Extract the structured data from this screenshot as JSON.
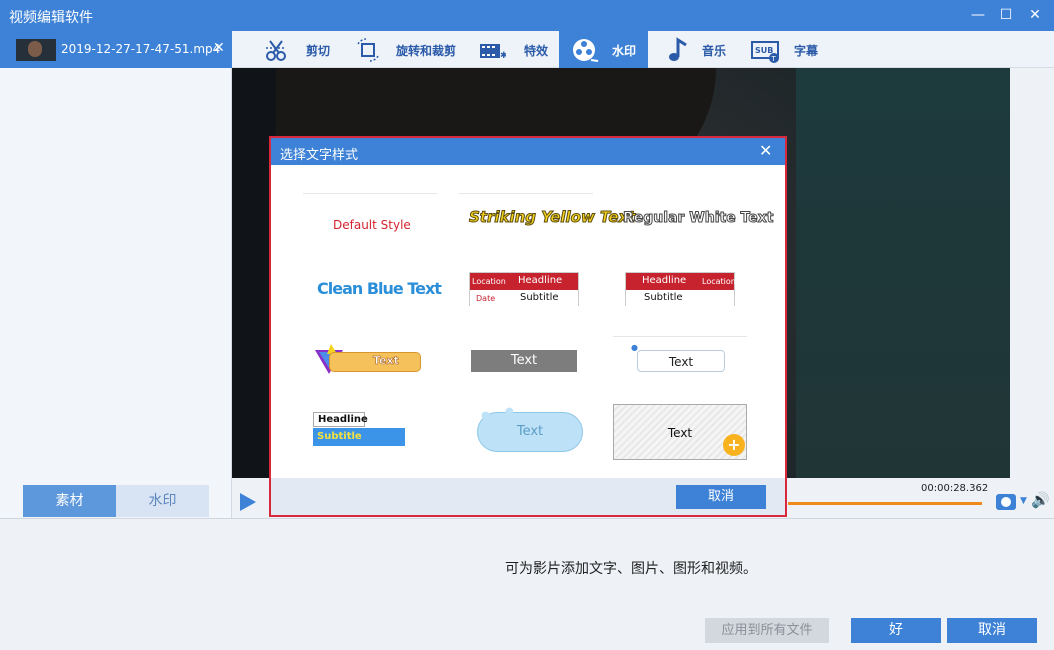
{
  "window": {
    "title": "视频编辑软件",
    "buttons": [
      "—",
      "☐",
      "✕"
    ]
  },
  "file_tab": {
    "name": "2019-12-27-17-47-51.mp4",
    "close": "✕"
  },
  "toolbar": {
    "tools": [
      {
        "label": "剪切",
        "icon": "scissors-icon"
      },
      {
        "label": "旋转和裁剪",
        "icon": "crop-rotate-icon"
      },
      {
        "label": "特效",
        "icon": "film-effects-icon"
      },
      {
        "label": "水印",
        "icon": "film-reel-icon"
      },
      {
        "label": "音乐",
        "icon": "music-note-icon"
      },
      {
        "label": "字幕",
        "icon": "subtitle-icon"
      }
    ]
  },
  "left_tabs": {
    "material": "素材",
    "watermark": "水印"
  },
  "player": {
    "time": "00:00:28.362"
  },
  "bottom": {
    "hint": "可为影片添加文字、图片、图形和视频。",
    "apply_all": "应用到所有文件",
    "ok": "好",
    "cancel": "取消"
  },
  "dialog": {
    "title": "选择文字样式",
    "close": "✕",
    "cancel": "取消",
    "styles": {
      "default": "Default Style",
      "yellow": "Striking Yellow Text",
      "white": "Regular White Text",
      "blue": "Clean Blue Text",
      "lower1": {
        "location": "Location",
        "headline": "Headline",
        "date": "Date",
        "subtitle": "Subtitle"
      },
      "lower2": {
        "headline": "Headline",
        "location": "Location",
        "subtitle": "Subtitle"
      },
      "badge": "Text",
      "gray": "Text",
      "bubble": "Text",
      "hs": {
        "headline": "Headline",
        "subtitle": "Subtitle"
      },
      "cloud": "Text",
      "sketch": "Text",
      "plus": "+"
    }
  },
  "colors": {
    "accent": "#3d82d6",
    "highlight_border": "#d9283c",
    "progress": "#f08a1c"
  }
}
